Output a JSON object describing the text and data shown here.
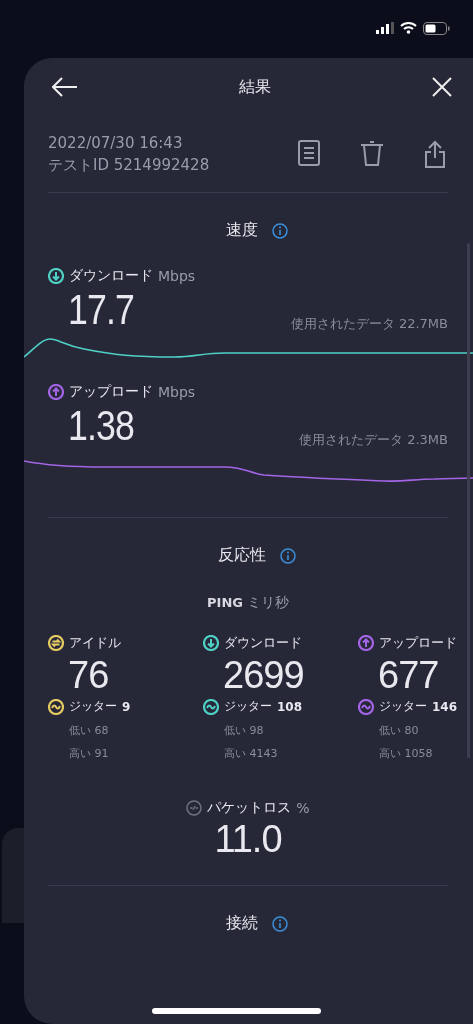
{
  "header": {
    "title": "結果"
  },
  "meta": {
    "date": "2022/07/30 16:43",
    "test_id": "テストID 5214992428"
  },
  "speed": {
    "title": "速度",
    "metrics": [
      {
        "kind": "download",
        "label": "ダウンロード",
        "unit": "Mbps",
        "value": "17.7",
        "data_used": "使用されたデータ 22.7MB",
        "color": "#4fd1c5"
      },
      {
        "kind": "upload",
        "label": "アップロード",
        "unit": "Mbps",
        "value": "1.38",
        "data_used": "使用されたデータ 2.3MB",
        "color": "#a365e6"
      }
    ]
  },
  "responsiveness": {
    "title": "反応性",
    "ping_label": "PING",
    "ping_unit": "ミリ秒",
    "columns": [
      {
        "kind": "idle",
        "label": "アイドル",
        "value": "76",
        "jitter_label": "ジッター",
        "jitter": "9",
        "low": "低い 68",
        "high": "高い 91",
        "color": "#e6cb63"
      },
      {
        "kind": "download",
        "label": "ダウンロード",
        "value": "2699",
        "jitter_label": "ジッター",
        "jitter": "108",
        "low": "低い 98",
        "high": "高い 4143",
        "color": "#4fd1c5"
      },
      {
        "kind": "upload",
        "label": "アップロード",
        "value": "677",
        "jitter_label": "ジッター",
        "jitter": "146",
        "low": "低い 80",
        "high": "高い 1058",
        "color": "#a365e6"
      }
    ]
  },
  "packet_loss": {
    "label": "パケットロス",
    "unit": "%",
    "value": "11.0"
  },
  "connection": {
    "title": "接続"
  }
}
